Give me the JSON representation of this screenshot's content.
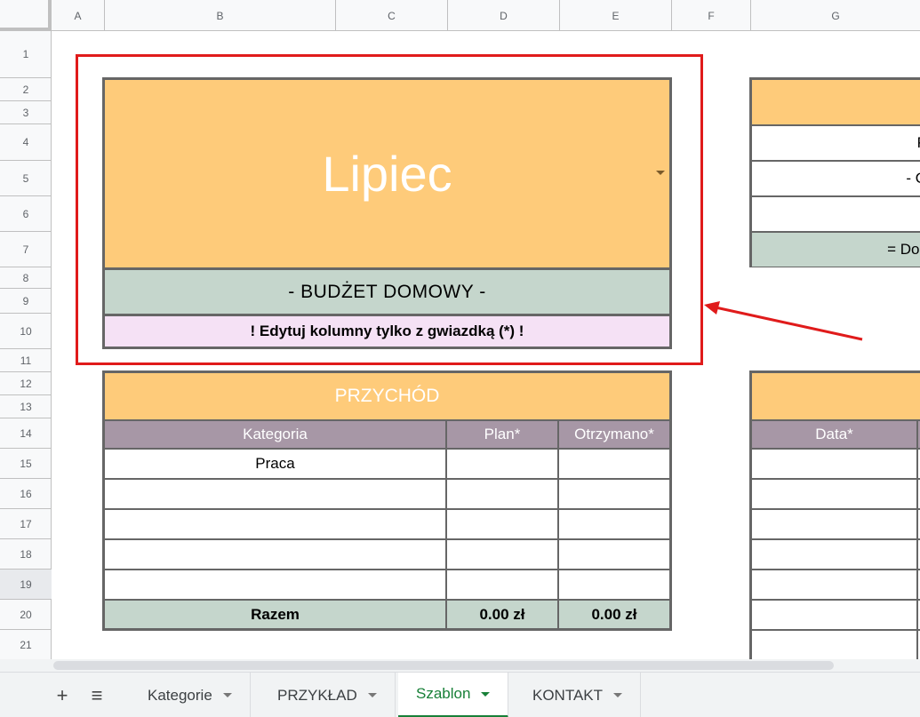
{
  "columns": [
    "A",
    "B",
    "C",
    "D",
    "E",
    "F",
    "G"
  ],
  "rows": [
    "1",
    "2",
    "3",
    "4",
    "5",
    "6",
    "7",
    "8",
    "9",
    "10",
    "11",
    "12",
    "13",
    "14",
    "15",
    "16",
    "17",
    "18",
    "19",
    "20",
    "21"
  ],
  "header_block": {
    "month": "Lipiec",
    "title": "- BUDŻET DOMOWY -",
    "edit_note": "! Edytuj kolumny tylko z gwiazdką (*) !"
  },
  "income_table": {
    "title": "PRZYCHÓD",
    "columns": [
      "Kategoria",
      "Plan*",
      "Otrzymano*"
    ],
    "rows": [
      [
        "Praca",
        "",
        ""
      ],
      [
        "",
        "",
        ""
      ],
      [
        "",
        "",
        ""
      ],
      [
        "",
        "",
        ""
      ],
      [
        "",
        "",
        ""
      ]
    ],
    "total": [
      "Razem",
      "0.00 zł",
      "0.00 zł"
    ]
  },
  "summary_partial": {
    "rows": [
      "P",
      "- O",
      "-",
      "= Dos"
    ]
  },
  "expense_partial": {
    "columns": [
      "Data*"
    ]
  },
  "sheet_tabs": {
    "add_label": "+",
    "list_label": "≡",
    "tabs": [
      {
        "label": "Kategorie"
      },
      {
        "label": "PRZYKŁAD"
      },
      {
        "label": "Szablon"
      },
      {
        "label": "KONTAKT"
      }
    ]
  },
  "colors": {
    "orange": "#fecb7a",
    "sage": "#c5d6cc",
    "mauve": "#a797a6",
    "pink": "#f5e1f5",
    "highlight_red": "#e01b1b",
    "active_tab_green": "#188038"
  }
}
